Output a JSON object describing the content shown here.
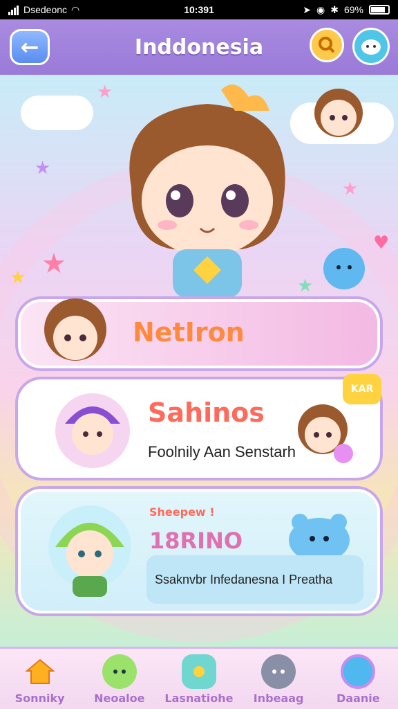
{
  "status": {
    "carrier": "Dsedeonc",
    "time": "10:391",
    "battery": "69%"
  },
  "header": {
    "title": "Inddonesia"
  },
  "cards": [
    {
      "title": "NetIron"
    },
    {
      "title": "Sahinos",
      "badge": "KAR",
      "subtitle": "Foolnily Aan Senstarh"
    },
    {
      "label": "Sheepew !",
      "code": "18RINO",
      "info": "Ssaknvbr Infedanesna I Preatha"
    }
  ],
  "nav": [
    {
      "label": "Sonniky"
    },
    {
      "label": "Neoaloe"
    },
    {
      "label": "Lasnatiohe"
    },
    {
      "label": "Inbeaag"
    },
    {
      "label": "Daanie"
    }
  ],
  "colors": {
    "accent": "#9a7ad8",
    "nav_label": "#a970c9"
  }
}
